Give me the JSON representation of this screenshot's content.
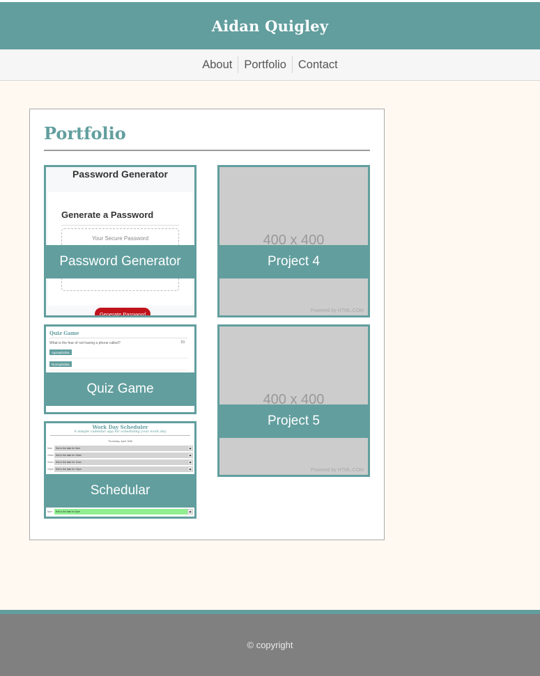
{
  "header": {
    "title": "Aidan Quigley"
  },
  "nav": {
    "items": [
      "About",
      "Portfolio",
      "Contact"
    ]
  },
  "portfolio": {
    "heading": "Portfolio",
    "projects": [
      {
        "label": "Password Generator"
      },
      {
        "label": "Project 4"
      },
      {
        "label": "Quiz Game"
      },
      {
        "label": "Project 5"
      },
      {
        "label": "Schedular"
      }
    ]
  },
  "thumbs": {
    "password": {
      "title": "Password Generator",
      "heading": "Generate a Password",
      "placeholder": "Your Secure Password",
      "button": "Generate Password"
    },
    "placeholder": {
      "size": "400 x 400",
      "powered": "Powered by HTML.COM"
    },
    "quiz": {
      "title": "Quiz Game",
      "question": "What is the fear of not having a phone called?",
      "score": "53",
      "answers": [
        "Agoraphobia",
        "Nomophobia"
      ]
    },
    "sched": {
      "title": "Work Day Scheduler",
      "subtitle": "A simple calendar app for scheduling your work day",
      "date": "Thursday, April 30th",
      "rows": [
        {
          "hour": "9am",
          "task": "this is the task for 9am"
        },
        {
          "hour": "10am",
          "task": "this is the task for 10am"
        },
        {
          "hour": "11am",
          "task": "this is the task for 11am"
        },
        {
          "hour": "12pm",
          "task": "this is the task for 12pm"
        },
        {
          "hour": "5pm",
          "task": "this is the task for 5pm"
        }
      ]
    }
  },
  "footer": {
    "text": "© copyright"
  },
  "colors": {
    "accent": "#629e9e",
    "background": "#fff9f1",
    "footer": "#808080"
  }
}
